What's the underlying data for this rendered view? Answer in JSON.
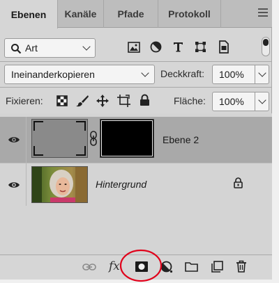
{
  "tabs": [
    {
      "label": "Ebenen"
    },
    {
      "label": "Kanäle"
    },
    {
      "label": "Pfade"
    },
    {
      "label": "Protokoll"
    }
  ],
  "filter": {
    "kind_value": "Art"
  },
  "blend": {
    "mode_value": "Ineinanderkopieren",
    "opacity_label": "Deckkraft:",
    "opacity_value": "100%"
  },
  "lock": {
    "label": "Fixieren:",
    "fill_label": "Fläche:",
    "fill_value": "100%"
  },
  "layers": [
    {
      "name": "Ebene 2",
      "italic": false,
      "selected": true
    },
    {
      "name": "Hintergrund",
      "italic": true,
      "selected": false
    }
  ],
  "bottom": {
    "fx_label": "fx"
  },
  "colors": {
    "highlight_circle": "#e0001a"
  }
}
